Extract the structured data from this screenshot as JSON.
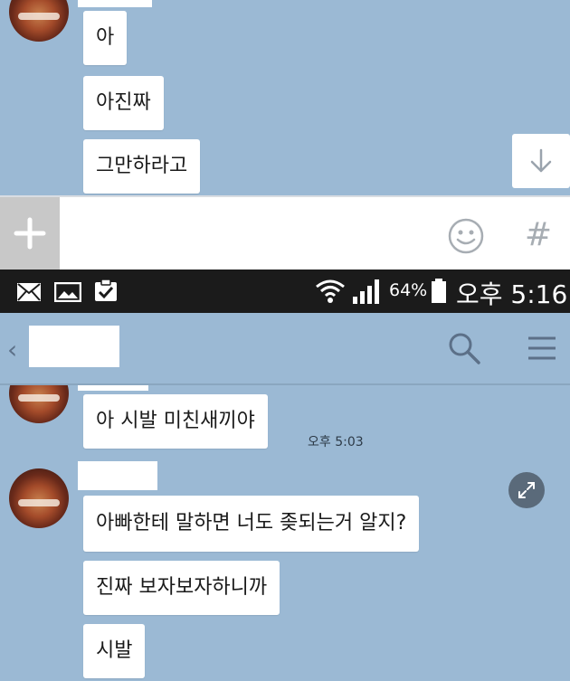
{
  "top_chat": {
    "messages": [
      {
        "text": "아"
      },
      {
        "text": "아진짜"
      },
      {
        "text": "그만하라고"
      }
    ]
  },
  "input_bar": {
    "plus_icon": "plus-icon",
    "emoji_icon": "emoji-icon",
    "hashtag_label": "#"
  },
  "status_bar": {
    "icons": [
      "mail-icon",
      "image-icon",
      "clipboard-check-icon",
      "wifi-icon",
      "signal-icon",
      "battery-icon"
    ],
    "battery_percent": "64%",
    "time": "오후 5:16"
  },
  "header": {
    "back_label": "‹",
    "search_icon": "search-icon",
    "menu_icon": "menu-icon"
  },
  "bottom_chat": {
    "group1": {
      "messages": [
        {
          "text": "아 시발 미친새끼야",
          "time": "오후 5:03"
        }
      ]
    },
    "group2": {
      "messages": [
        {
          "text": "아빠한테 말하면 너도 좆되는거 알지?"
        },
        {
          "text": "진짜 보자보자하니까"
        },
        {
          "text": "시발"
        }
      ]
    }
  },
  "colors": {
    "chat_background": "#9bb9d4",
    "bubble": "#ffffff",
    "status_bar": "#1b1b1b"
  }
}
